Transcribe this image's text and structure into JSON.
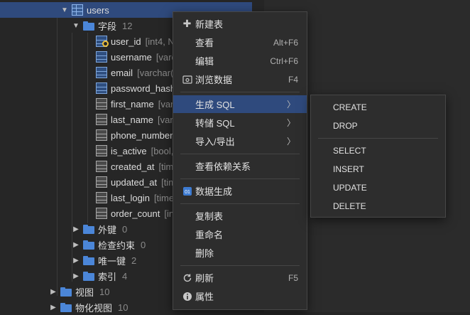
{
  "tree": {
    "table": {
      "label": "users"
    },
    "fields_group": {
      "label": "字段",
      "count": "12"
    },
    "fields": [
      {
        "name": "user_id",
        "meta": "[int4, N"
      },
      {
        "name": "username",
        "meta": "[varc"
      },
      {
        "name": "email",
        "meta": "[varchar("
      },
      {
        "name": "password_hash",
        "meta": ""
      },
      {
        "name": "first_name",
        "meta": "[varc"
      },
      {
        "name": "last_name",
        "meta": "[varc"
      },
      {
        "name": "phone_number",
        "meta": ""
      },
      {
        "name": "is_active",
        "meta": "[bool, "
      },
      {
        "name": "created_at",
        "meta": "[tim"
      },
      {
        "name": "updated_at",
        "meta": "[tim"
      },
      {
        "name": "last_login",
        "meta": "[time"
      },
      {
        "name": "order_count",
        "meta": "[in"
      }
    ],
    "groups": [
      {
        "label": "外键",
        "count": "0"
      },
      {
        "label": "检查约束",
        "count": "0"
      },
      {
        "label": "唯一键",
        "count": "2"
      },
      {
        "label": "索引",
        "count": "4"
      }
    ],
    "schema_groups": [
      {
        "label": "视图",
        "count": "10"
      },
      {
        "label": "物化视图",
        "count": "10"
      }
    ]
  },
  "context_menu": {
    "new_table": {
      "label": "新建表",
      "icon": "plus-icon"
    },
    "view": {
      "label": "查看",
      "shortcut": "Alt+F6"
    },
    "edit": {
      "label": "编辑",
      "shortcut": "Ctrl+F6"
    },
    "browse": {
      "label": "浏览数据",
      "shortcut": "F4",
      "icon": "browse-data-icon"
    },
    "generate_sql": {
      "label": "生成 SQL"
    },
    "dump_sql": {
      "label": "转储 SQL"
    },
    "import_export": {
      "label": "导入/导出"
    },
    "view_deps": {
      "label": "查看依赖关系"
    },
    "data_gen": {
      "label": "数据生成",
      "icon": "data-generation-icon"
    },
    "copy_table": {
      "label": "复制表"
    },
    "rename": {
      "label": "重命名"
    },
    "delete": {
      "label": "删除"
    },
    "refresh": {
      "label": "刷新",
      "shortcut": "F5",
      "icon": "refresh-icon"
    },
    "properties": {
      "label": "属性",
      "icon": "info-icon"
    }
  },
  "submenu": {
    "create": "CREATE",
    "drop": "DROP",
    "select": "SELECT",
    "insert": "INSERT",
    "update": "UPDATE",
    "delete": "DELETE"
  },
  "colors": {
    "selection": "#2f4a7d",
    "folder": "#4b86d8",
    "key": "#f0c23a"
  }
}
